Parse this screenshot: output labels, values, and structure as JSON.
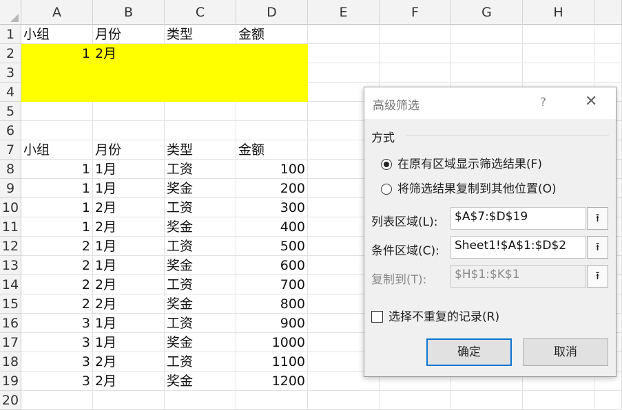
{
  "columns": [
    "A",
    "B",
    "C",
    "D",
    "E",
    "F",
    "G",
    "H"
  ],
  "rows": [
    "1",
    "2",
    "3",
    "4",
    "5",
    "6",
    "7",
    "8",
    "9",
    "10",
    "11",
    "12",
    "13",
    "14",
    "15",
    "16",
    "17",
    "18",
    "19",
    "20"
  ],
  "cells": {
    "r1": [
      "小组",
      "月份",
      "类型",
      "金额"
    ],
    "r2": [
      "1",
      "2月",
      "",
      ""
    ],
    "r7": [
      "小组",
      "月份",
      "类型",
      "金额"
    ],
    "data": [
      [
        "1",
        "1月",
        "工资",
        "100"
      ],
      [
        "1",
        "1月",
        "奖金",
        "200"
      ],
      [
        "1",
        "2月",
        "工资",
        "300"
      ],
      [
        "1",
        "2月",
        "奖金",
        "400"
      ],
      [
        "2",
        "1月",
        "工资",
        "500"
      ],
      [
        "2",
        "1月",
        "奖金",
        "600"
      ],
      [
        "2",
        "2月",
        "工资",
        "700"
      ],
      [
        "2",
        "2月",
        "奖金",
        "800"
      ],
      [
        "3",
        "1月",
        "工资",
        "900"
      ],
      [
        "3",
        "1月",
        "奖金",
        "1000"
      ],
      [
        "3",
        "2月",
        "工资",
        "1100"
      ],
      [
        "3",
        "2月",
        "奖金",
        "1200"
      ]
    ]
  },
  "highlight_color": "#ffff00",
  "dialog": {
    "title": "高级筛选",
    "help": "?",
    "close": "✕",
    "group_label": "方式",
    "option1": "在原有区域显示筛选结果(F)",
    "option2": "将筛选结果复制到其他位置(O)",
    "option1_selected": true,
    "list_range_label": "列表区域(L):",
    "list_range_value": "$A$7:$D$19",
    "criteria_range_label": "条件区域(C):",
    "criteria_range_value": "Sheet1!$A$1:$D$2",
    "copy_to_label": "复制到(T):",
    "copy_to_value": "$H$1:$K$1",
    "collapse_icon": "collapse-range-icon",
    "unique_label": "选择不重复的记录(R)",
    "unique_checked": false,
    "ok_label": "确定",
    "cancel_label": "取消",
    "ok_border_color": "#0a74d0"
  }
}
